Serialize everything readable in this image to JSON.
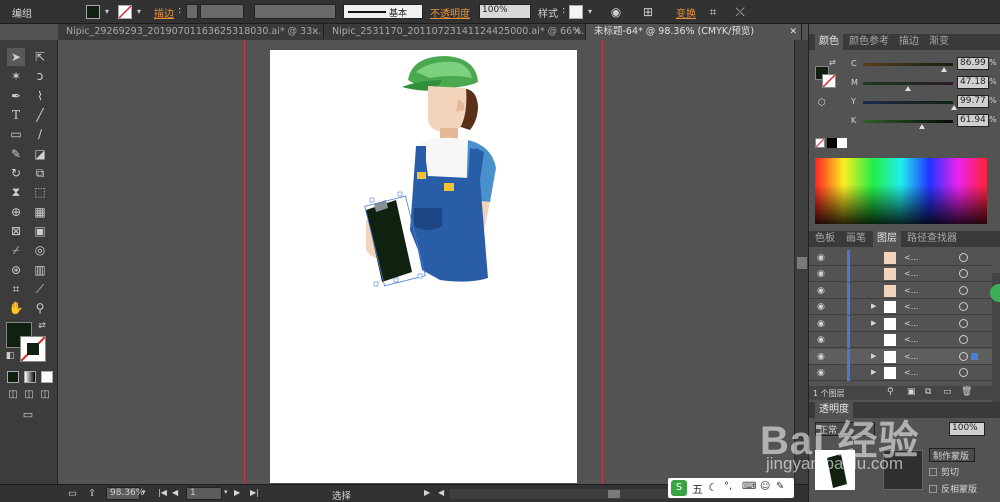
{
  "control_bar": {
    "selection_label": "编组",
    "stroke_label": "描边",
    "stroke_profile": "基本",
    "opacity_label": "不透明度",
    "opacity_value": "100%",
    "style_label": "样式",
    "transform_label": "变换"
  },
  "tabs": [
    {
      "label": "Nipic_29269293_20190701163625318030.ai* @ 33...",
      "close": "✕"
    },
    {
      "label": "Nipic_2531170_20110723141124425000.ai* @ 66%...",
      "close": "✕"
    },
    {
      "label": "未标题-64* @ 98.36% (CMYK/预览)",
      "close": "✕"
    }
  ],
  "status_bar": {
    "zoom": "98.36%",
    "page": "1",
    "tool": "选择"
  },
  "color_panel": {
    "tabs": [
      "颜色",
      "颜色参考",
      "描边",
      "渐变"
    ],
    "sliders": [
      {
        "letter": "C",
        "value": "86.99",
        "unit": "%",
        "level": 0.87
      },
      {
        "letter": "M",
        "value": "47.18",
        "unit": "%",
        "level": 0.47
      },
      {
        "letter": "Y",
        "value": "99.77",
        "unit": "%",
        "level": 0.99
      },
      {
        "letter": "K",
        "value": "61.94",
        "unit": "%",
        "level": 0.62
      }
    ]
  },
  "layers_panel": {
    "tabs": [
      "色板",
      "画笔",
      "图层",
      "路径查找器"
    ],
    "rows": [
      {
        "name": "<...",
        "has_expand": false
      },
      {
        "name": "<...",
        "has_expand": false
      },
      {
        "name": "<...",
        "has_expand": false
      },
      {
        "name": "<...",
        "has_expand": true
      },
      {
        "name": "<...",
        "has_expand": true
      },
      {
        "name": "<...",
        "has_expand": false
      },
      {
        "name": "<...",
        "has_expand": true
      },
      {
        "name": "<...",
        "has_expand": true
      }
    ],
    "footer_count": "1 个图层"
  },
  "transparency_panel": {
    "tab": "透明度",
    "mode": "正常",
    "opacity": "100%",
    "make_mask": "制作蒙版",
    "clip": "剪切",
    "invert_mask": "反相蒙版"
  },
  "ime": {
    "text": "五"
  },
  "watermark": {
    "brand": "Bai 经验",
    "url": "jingyan.baidu.com"
  },
  "colors": {
    "fill": "#10210f",
    "guide": "#c8373a",
    "accent_orange": "#e8913a"
  }
}
